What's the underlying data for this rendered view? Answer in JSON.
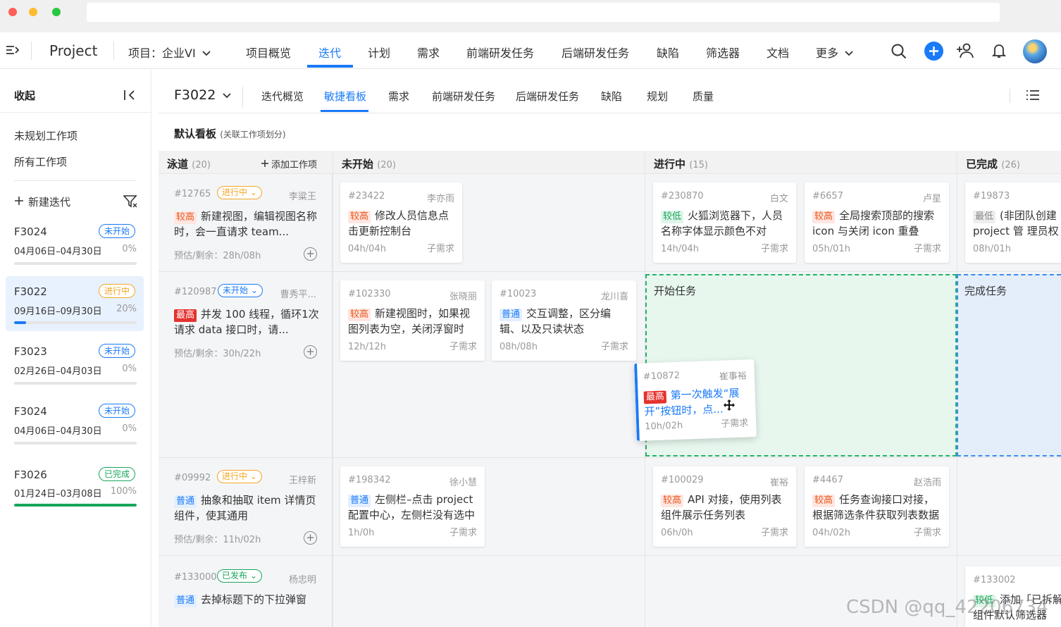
{
  "window": {
    "dots": [
      "#fe5f57",
      "#febc2e",
      "#28c840"
    ]
  },
  "topnav": {
    "app_name": "Project",
    "project_label": "项目：企业VI",
    "items": [
      "项目概览",
      "迭代",
      "计划",
      "需求",
      "前端研发任务",
      "后端研发任务",
      "缺陷",
      "筛选器",
      "文档",
      "更多"
    ],
    "active": "迭代",
    "accent": "#1a7af8"
  },
  "sidebar": {
    "collapse_label": "收起",
    "links": [
      "未规划工作项",
      "所有工作项"
    ],
    "new_iteration": "新建迭代",
    "iterations": [
      {
        "name": "F3024",
        "status": "未开始",
        "dates": "04月06日–04月30日",
        "progress": "0%"
      },
      {
        "name": "F3022",
        "status": "进行中",
        "dates": "09月16日–09月30日",
        "progress": "20%"
      },
      {
        "name": "F3023",
        "status": "未开始",
        "dates": "02月26日–04月03日",
        "progress": "0%"
      },
      {
        "name": "F3024",
        "status": "未开始",
        "dates": "04月06日–04月30日",
        "progress": "0%"
      },
      {
        "name": "F3026",
        "status": "已完成",
        "dates": "01月24日–03月08日",
        "progress": "100%"
      }
    ]
  },
  "main": {
    "iteration": "F3022",
    "tabs": [
      "迭代概览",
      "敏捷看板",
      "需求",
      "前端研发任务",
      "后端研发任务",
      "缺陷",
      "规划",
      "质量"
    ],
    "active_tab": "敏捷看板",
    "board_title": "默认看板",
    "board_subtitle": "(关联工作项划分)"
  },
  "board": {
    "columns": [
      {
        "name": "泳道",
        "count": "(20)",
        "action": "添加工作项"
      },
      {
        "name": "未开始",
        "count": "(20)"
      },
      {
        "name": "进行中",
        "count": "(15)"
      },
      {
        "name": "已完成",
        "count": "(26)"
      }
    ],
    "lanes": [
      {
        "id": "#12765",
        "status": "进行中",
        "owner": "李粱王",
        "prio": "较高",
        "title": "新建视图，编辑视图名称时，会一直请求 team...",
        "est": "预估/剩余：28h/08h"
      },
      {
        "id": "#120987",
        "status": "未开始",
        "owner": "曹秀平...",
        "prio": "最高",
        "title": "并发 100 线程，循环1次请求 data 接口时，请...",
        "est": "预估/剩余：30h/22h"
      },
      {
        "id": "#09992",
        "status": "进行中",
        "owner": "王梓新",
        "prio": "普通",
        "title": "抽象和抽取 item 详情页组件，使其通用",
        "est": "预估/剩余：11h/02h"
      },
      {
        "id": "#133000",
        "status": "已发布",
        "owner": "杨忠明",
        "prio": "普通",
        "title": "去掉标题下的下拉弹窗",
        "est": ""
      }
    ],
    "cards": [
      {
        "id": "#23422",
        "owner": "李亦雨",
        "prio": "较高",
        "title": "修改人员信息点击更新控制台",
        "est": "04h/04h",
        "sub": "子需求"
      },
      {
        "id": "#230870",
        "owner": "白文",
        "prio": "较低",
        "title": "火狐浏览器下，人员名称字体显示颜色不对",
        "est": "14h/04h",
        "sub": "子需求"
      },
      {
        "id": "#6657",
        "owner": "卢星",
        "prio": "较高",
        "title": "全局搜索顶部的搜索 icon 与关闭 icon 重叠",
        "est": "05h/01h",
        "sub": "子需求"
      },
      {
        "id": "#19873",
        "owner": "",
        "prio": "最低",
        "title": "(非团队创建 project 管 理员权",
        "est": "08h/01h",
        "sub": ""
      },
      {
        "id": "#102330",
        "owner": "张晓丽",
        "prio": "较高",
        "title": "新建视图时，如果视图列表为空，关闭浮窗时",
        "est": "12h/12h",
        "sub": "子需求"
      },
      {
        "id": "#10023",
        "owner": "龙川喜",
        "prio": "普通",
        "title": "交互调整，区分编辑、以及只读状态",
        "est": "08h/08h",
        "sub": "子需求"
      },
      {
        "id": "#10872",
        "owner": "崔事裕",
        "prio": "最高",
        "title": "第一次触发“展开”按钮时，点...",
        "est": "10h/02h",
        "sub": "子需求"
      },
      {
        "id": "#198342",
        "owner": "徐小慧",
        "prio": "普通",
        "title": "左侧栏–点击 project 配置中心，左侧栏没有选中",
        "est": "1h/0h",
        "sub": "子需求"
      },
      {
        "id": "#100029",
        "owner": "崔裕",
        "prio": "较高",
        "title": "API 对接，使用列表组件展示任务列表",
        "est": "06h/0h",
        "sub": "子需求"
      },
      {
        "id": "#4467",
        "owner": "赵浩雨",
        "prio": "较高",
        "title": "任务查询接口对接，根据筛选条件获取列表数据",
        "est": "04h/02h",
        "sub": "子需求"
      },
      {
        "id": "#133002",
        "owner": "",
        "prio": "较低",
        "title": "添加「已拆解」组件默认筛选器",
        "est": "",
        "sub": ""
      }
    ],
    "dropzones": [
      "开始任务",
      "完成任务"
    ]
  },
  "watermark": "CSDN @qq_42206734"
}
